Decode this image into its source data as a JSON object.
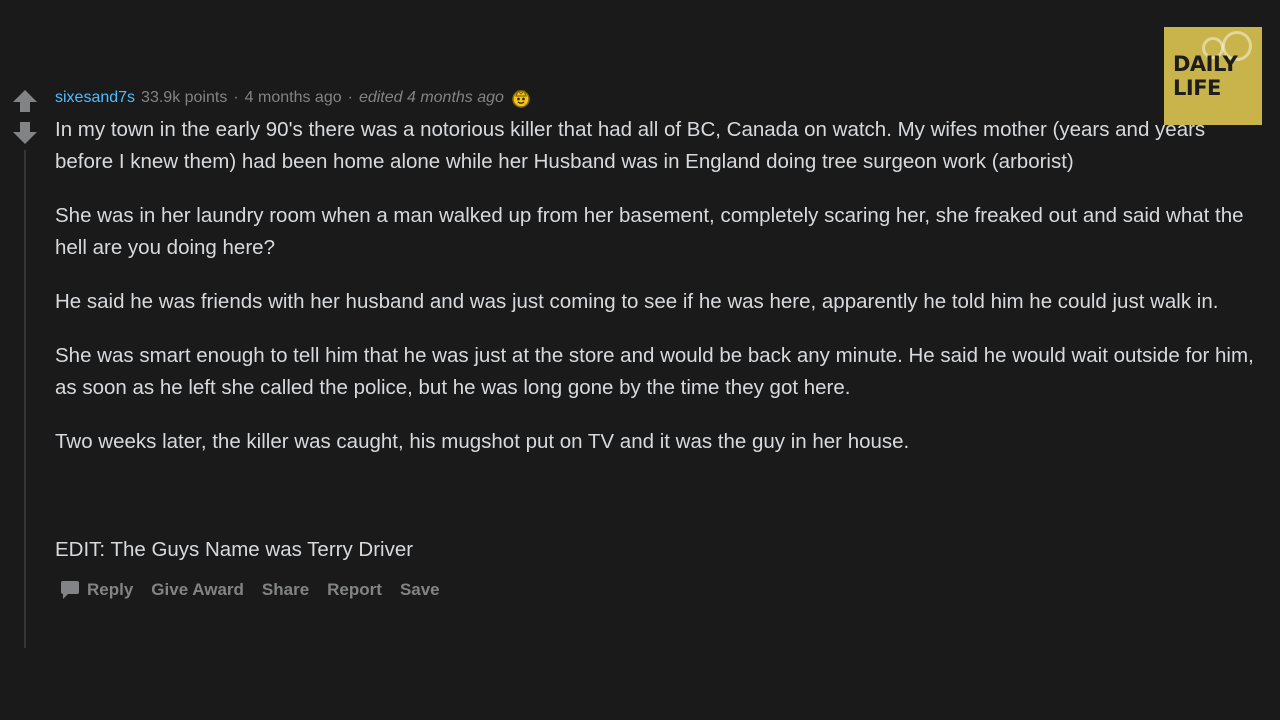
{
  "comment": {
    "author": "sixesand7s",
    "points": "33.9k points",
    "separator": "·",
    "time": "4 months ago",
    "edited": "edited 4 months ago",
    "award_icon": "award-icon",
    "paragraphs": [
      "In my town in the early 90's there was a notorious killer that had all of BC, Canada on watch. My wifes mother (years and years before I knew them) had been home alone while her Husband was in England doing tree surgeon work (arborist)",
      "She was in her laundry room when a man walked up from her basement, completely scaring her, she freaked out and said what the hell are you doing here?",
      "He said he was friends with her husband and was just coming to see if he was here, apparently he told him he could just walk in.",
      "She was smart enough to tell him that he was just at the store and would be back any minute. He said he would wait outside for him, as soon as he left she called the police, but he was long gone by the time they got here.",
      "Two weeks later, the killer was caught, his mugshot put on TV and it was the guy in her house."
    ],
    "edit_note": "EDIT: The Guys Name was Terry Driver"
  },
  "actions": {
    "reply": "Reply",
    "give_award": "Give Award",
    "share": "Share",
    "report": "Report",
    "save": "Save"
  },
  "logo": {
    "line1": "DAILY",
    "line2": "LIFE",
    "background": "#c8b44a"
  },
  "colors": {
    "background": "#1a1a1b",
    "author": "#4fbcff",
    "text": "#d7dadc",
    "muted": "#818384",
    "award": "#f5c518"
  }
}
